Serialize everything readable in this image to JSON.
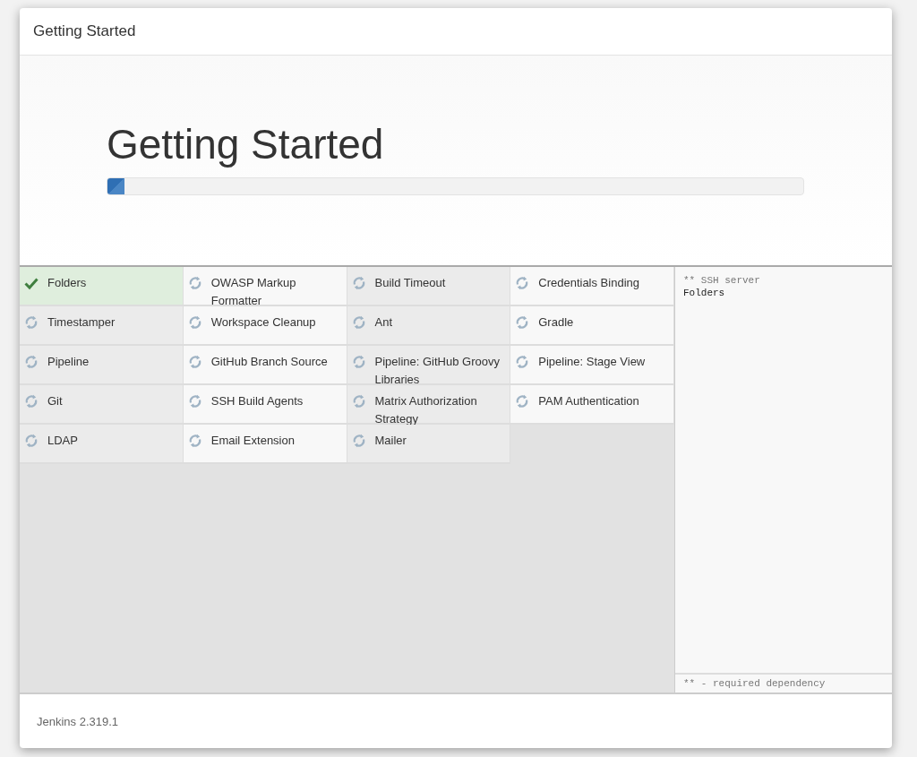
{
  "window": {
    "title": "Getting Started"
  },
  "hero": {
    "title": "Getting Started",
    "progress": {
      "level": 0.025
    }
  },
  "plugins": [
    {
      "name": "Folders",
      "installed": true
    },
    {
      "name": "OWASP Markup Formatter",
      "installed": false
    },
    {
      "name": "Build Timeout",
      "installed": false
    },
    {
      "name": "Credentials Binding",
      "installed": false
    },
    {
      "name": "Timestamper",
      "installed": false
    },
    {
      "name": "Workspace Cleanup",
      "installed": false
    },
    {
      "name": "Ant",
      "installed": false
    },
    {
      "name": "Gradle",
      "installed": false
    },
    {
      "name": "Pipeline",
      "installed": false
    },
    {
      "name": "GitHub Branch Source",
      "installed": false
    },
    {
      "name": "Pipeline: GitHub Groovy Libraries",
      "installed": false
    },
    {
      "name": "Pipeline: Stage View",
      "installed": false
    },
    {
      "name": "Git",
      "installed": false
    },
    {
      "name": "SSH Build Agents",
      "installed": false
    },
    {
      "name": "Matrix Authorization Strategy",
      "installed": false
    },
    {
      "name": "PAM Authentication",
      "installed": false
    },
    {
      "name": "LDAP",
      "installed": false
    },
    {
      "name": "Email Extension",
      "installed": false
    },
    {
      "name": "Mailer",
      "installed": false
    }
  ],
  "log": {
    "lines": [
      {
        "text": "** SSH server",
        "kind": "dependency"
      },
      {
        "text": "Folders",
        "kind": "plugin"
      }
    ],
    "legend": "** - required dependency"
  },
  "footer": {
    "version": "Jenkins 2.319.1"
  }
}
